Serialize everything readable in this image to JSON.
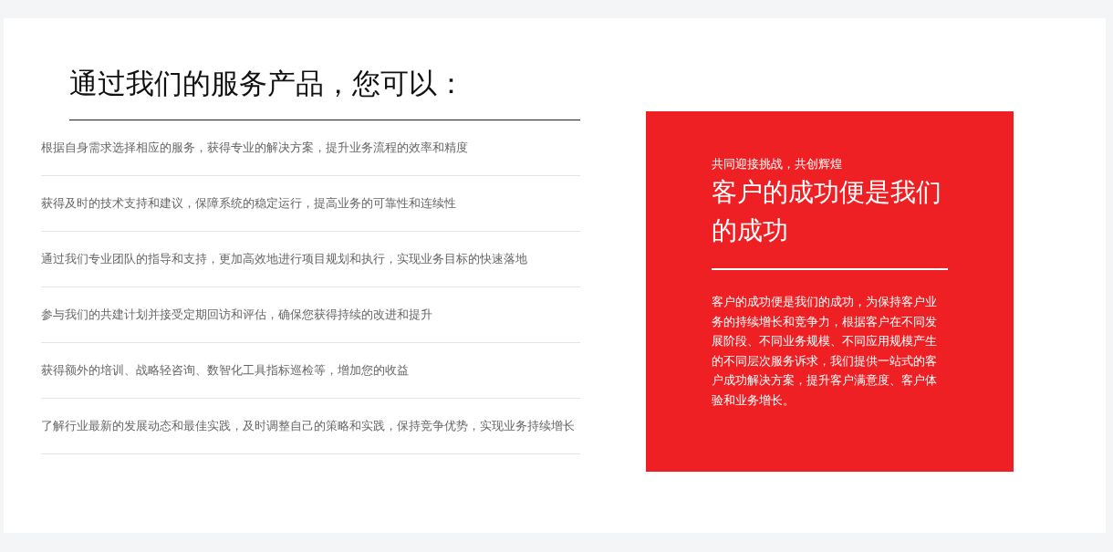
{
  "heading": "通过我们的服务产品，您可以：",
  "benefits": [
    "根据自身需求选择相应的服务，获得专业的解决方案，提升业务流程的效率和精度",
    "获得及时的技术支持和建议，保障系统的稳定运行，提高业务的可靠性和连续性",
    "通过我们专业团队的指导和支持，更加高效地进行项目规划和执行，实现业务目标的快速落地",
    "参与我们的共建计划并接受定期回访和评估，确保您获得持续的改进和提升",
    "获得额外的培训、战略轻咨询、数智化工具指标巡检等，增加您的收益",
    "了解行业最新的发展动态和最佳实践，及时调整自己的策略和实践，保持竞争优势，实现业务持续增长"
  ],
  "promo": {
    "tagline": "共同迎接挑战，共创辉煌",
    "title": "客户的成功便是我们的成功",
    "body": "客户的成功便是我们的成功，为保持客户业务的持续增长和竞争力，根据客户在不同发展阶段、不同业务规模、不同应用规模产生的不同层次服务诉求，我们提供一站式的客户成功解决方案，提升客户满意度、客户体验和业务增长。"
  }
}
